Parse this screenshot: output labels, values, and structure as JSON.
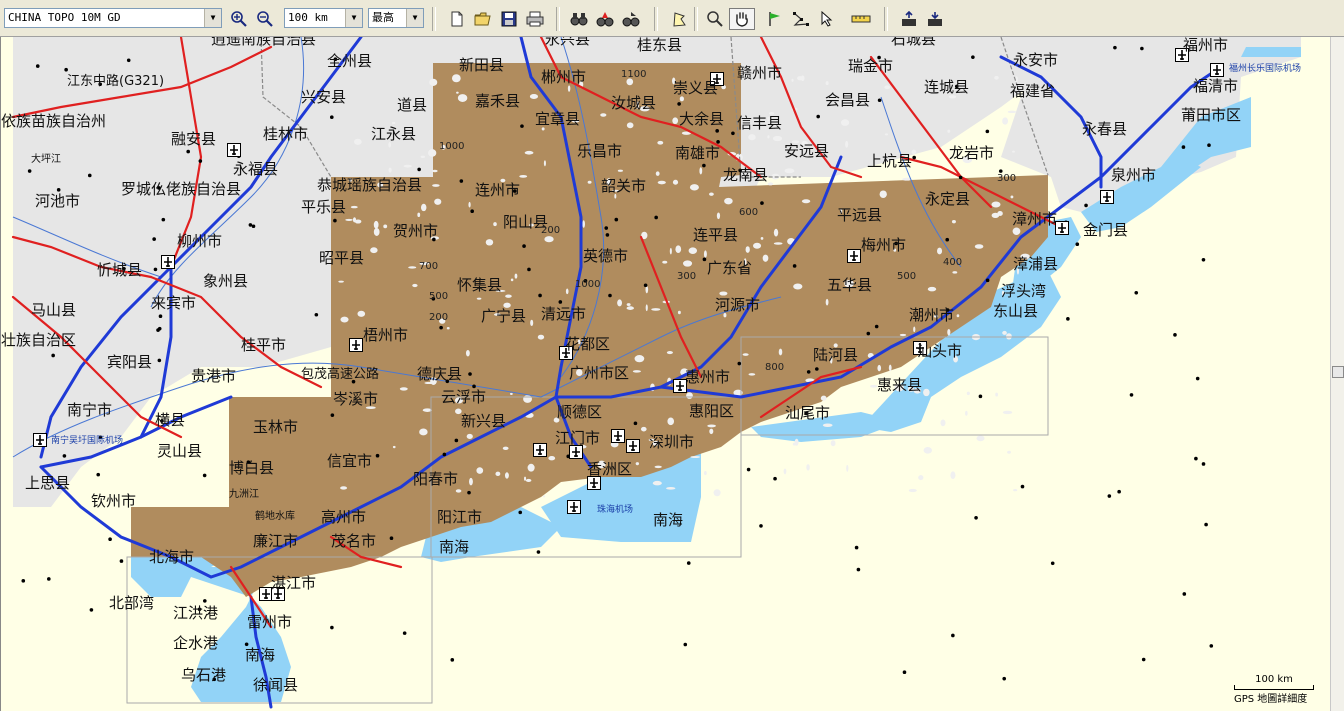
{
  "toolbar": {
    "map_product": "CHINA TOPO 10M GD",
    "scale": "100 km",
    "detail": "最高"
  },
  "map": {
    "scale_label": "100 km",
    "detail_label": "GPS 地圖詳細度",
    "labels": [
      {
        "text": "逍遥南族自治县",
        "cls": ""
      },
      {
        "text": "永兴县",
        "cls": ""
      },
      {
        "text": "桂东县",
        "cls": ""
      },
      {
        "text": "石城县",
        "cls": ""
      },
      {
        "text": "福州市",
        "cls": ""
      },
      {
        "text": "全州县",
        "cls": ""
      },
      {
        "text": "新田县",
        "cls": ""
      },
      {
        "text": "郴州市",
        "cls": ""
      },
      {
        "text": "1100",
        "cls": "contour"
      },
      {
        "text": "崇义县",
        "cls": ""
      },
      {
        "text": "赣州市",
        "cls": ""
      },
      {
        "text": "瑞金市",
        "cls": ""
      },
      {
        "text": "永安市",
        "cls": ""
      },
      {
        "text": "福州长乐国际机场",
        "cls": "blue"
      },
      {
        "text": "江东中路(G321)",
        "cls": "sm"
      },
      {
        "text": "兴安县",
        "cls": ""
      },
      {
        "text": "道县",
        "cls": ""
      },
      {
        "text": "嘉禾县",
        "cls": ""
      },
      {
        "text": "汝城县",
        "cls": ""
      },
      {
        "text": "会昌县",
        "cls": ""
      },
      {
        "text": "连城县",
        "cls": ""
      },
      {
        "text": "福建省",
        "cls": ""
      },
      {
        "text": "福清市",
        "cls": ""
      },
      {
        "text": "依族苗族自治州",
        "cls": ""
      },
      {
        "text": "宜章县",
        "cls": ""
      },
      {
        "text": "大余县",
        "cls": ""
      },
      {
        "text": "信丰县",
        "cls": ""
      },
      {
        "text": "融安县",
        "cls": ""
      },
      {
        "text": "桂林市",
        "cls": ""
      },
      {
        "text": "江永县",
        "cls": ""
      },
      {
        "text": "永春县",
        "cls": ""
      },
      {
        "text": "莆田市区",
        "cls": ""
      },
      {
        "text": "1000",
        "cls": "contour"
      },
      {
        "text": "乐昌市",
        "cls": ""
      },
      {
        "text": "南雄市",
        "cls": ""
      },
      {
        "text": "安远县",
        "cls": ""
      },
      {
        "text": "龙岩市",
        "cls": ""
      },
      {
        "text": "大坪江",
        "cls": "xs"
      },
      {
        "text": "永福县",
        "cls": ""
      },
      {
        "text": "上杭县",
        "cls": ""
      },
      {
        "text": "龙南县",
        "cls": ""
      },
      {
        "text": "300",
        "cls": "contour"
      },
      {
        "text": "泉州市",
        "cls": ""
      },
      {
        "text": "恭城瑶族自治县",
        "cls": ""
      },
      {
        "text": "连州市",
        "cls": ""
      },
      {
        "text": "韶关市",
        "cls": ""
      },
      {
        "text": "罗城仫佬族自治县",
        "cls": ""
      },
      {
        "text": "河池市",
        "cls": ""
      },
      {
        "text": "平乐县",
        "cls": ""
      },
      {
        "text": "永定县",
        "cls": ""
      },
      {
        "text": "600",
        "cls": "contour"
      },
      {
        "text": "平远县",
        "cls": ""
      },
      {
        "text": "漳州市",
        "cls": ""
      },
      {
        "text": "贺州市",
        "cls": ""
      },
      {
        "text": "阳山县",
        "cls": ""
      },
      {
        "text": "200",
        "cls": "contour"
      },
      {
        "text": "连平县",
        "cls": ""
      },
      {
        "text": "金门县",
        "cls": ""
      },
      {
        "text": "柳州市",
        "cls": ""
      },
      {
        "text": "梅州市",
        "cls": ""
      },
      {
        "text": "昭平县",
        "cls": ""
      },
      {
        "text": "英德市",
        "cls": ""
      },
      {
        "text": "广东省",
        "cls": ""
      },
      {
        "text": "400",
        "cls": "contour"
      },
      {
        "text": "漳浦县",
        "cls": ""
      },
      {
        "text": "忻城县",
        "cls": ""
      },
      {
        "text": "700",
        "cls": "contour"
      },
      {
        "text": "300",
        "cls": "contour"
      },
      {
        "text": "象州县",
        "cls": ""
      },
      {
        "text": "怀集县",
        "cls": ""
      },
      {
        "text": "1000",
        "cls": "contour"
      },
      {
        "text": "五华县",
        "cls": ""
      },
      {
        "text": "500",
        "cls": "contour"
      },
      {
        "text": "浮头湾",
        "cls": ""
      },
      {
        "text": "马山县",
        "cls": ""
      },
      {
        "text": "来宾市",
        "cls": ""
      },
      {
        "text": "500",
        "cls": "contour"
      },
      {
        "text": "广宁县",
        "cls": ""
      },
      {
        "text": "清远市",
        "cls": ""
      },
      {
        "text": "河源市",
        "cls": ""
      },
      {
        "text": "潮州市",
        "cls": ""
      },
      {
        "text": "东山县",
        "cls": ""
      },
      {
        "text": "壮族自治区",
        "cls": ""
      },
      {
        "text": "梧州市",
        "cls": ""
      },
      {
        "text": "花都区",
        "cls": ""
      },
      {
        "text": "桂平市",
        "cls": ""
      },
      {
        "text": "200",
        "cls": "contour"
      },
      {
        "text": "陆河县",
        "cls": ""
      },
      {
        "text": "汕头市",
        "cls": ""
      },
      {
        "text": "宾阳县",
        "cls": ""
      },
      {
        "text": "800",
        "cls": "contour"
      },
      {
        "text": "包茂高速公路",
        "cls": "sm"
      },
      {
        "text": "德庆县",
        "cls": ""
      },
      {
        "text": "广州市区",
        "cls": ""
      },
      {
        "text": "惠州市",
        "cls": ""
      },
      {
        "text": "惠来县",
        "cls": ""
      },
      {
        "text": "贵港市",
        "cls": ""
      },
      {
        "text": "南宁市",
        "cls": ""
      },
      {
        "text": "岑溪市",
        "cls": ""
      },
      {
        "text": "云浮市",
        "cls": ""
      },
      {
        "text": "顺德区",
        "cls": ""
      },
      {
        "text": "惠阳区",
        "cls": ""
      },
      {
        "text": "汕尾市",
        "cls": ""
      },
      {
        "text": "南宁吴圩国际机场",
        "cls": "blue"
      },
      {
        "text": "横县",
        "cls": ""
      },
      {
        "text": "玉林市",
        "cls": ""
      },
      {
        "text": "新兴县",
        "cls": ""
      },
      {
        "text": "江门市",
        "cls": ""
      },
      {
        "text": "深圳市",
        "cls": ""
      },
      {
        "text": "灵山县",
        "cls": ""
      },
      {
        "text": "信宜市",
        "cls": ""
      },
      {
        "text": "香洲区",
        "cls": ""
      },
      {
        "text": "博白县",
        "cls": ""
      },
      {
        "text": "阳春市",
        "cls": ""
      },
      {
        "text": "上思县",
        "cls": ""
      },
      {
        "text": "九洲江",
        "cls": "xs"
      },
      {
        "text": "钦州市",
        "cls": ""
      },
      {
        "text": "高州市",
        "cls": ""
      },
      {
        "text": "珠海机场",
        "cls": "blue"
      },
      {
        "text": "鹤地水库",
        "cls": "xs"
      },
      {
        "text": "阳江市",
        "cls": ""
      },
      {
        "text": "南海",
        "cls": ""
      },
      {
        "text": "廉江市",
        "cls": ""
      },
      {
        "text": "茂名市",
        "cls": ""
      },
      {
        "text": "南海",
        "cls": ""
      },
      {
        "text": "北海市",
        "cls": ""
      },
      {
        "text": "湛江市",
        "cls": ""
      },
      {
        "text": "北部湾",
        "cls": ""
      },
      {
        "text": "江洪港",
        "cls": ""
      },
      {
        "text": "雷州市",
        "cls": ""
      },
      {
        "text": "企水港",
        "cls": ""
      },
      {
        "text": "南海",
        "cls": ""
      },
      {
        "text": "乌石港",
        "cls": ""
      },
      {
        "text": "徐闻县",
        "cls": ""
      }
    ]
  }
}
